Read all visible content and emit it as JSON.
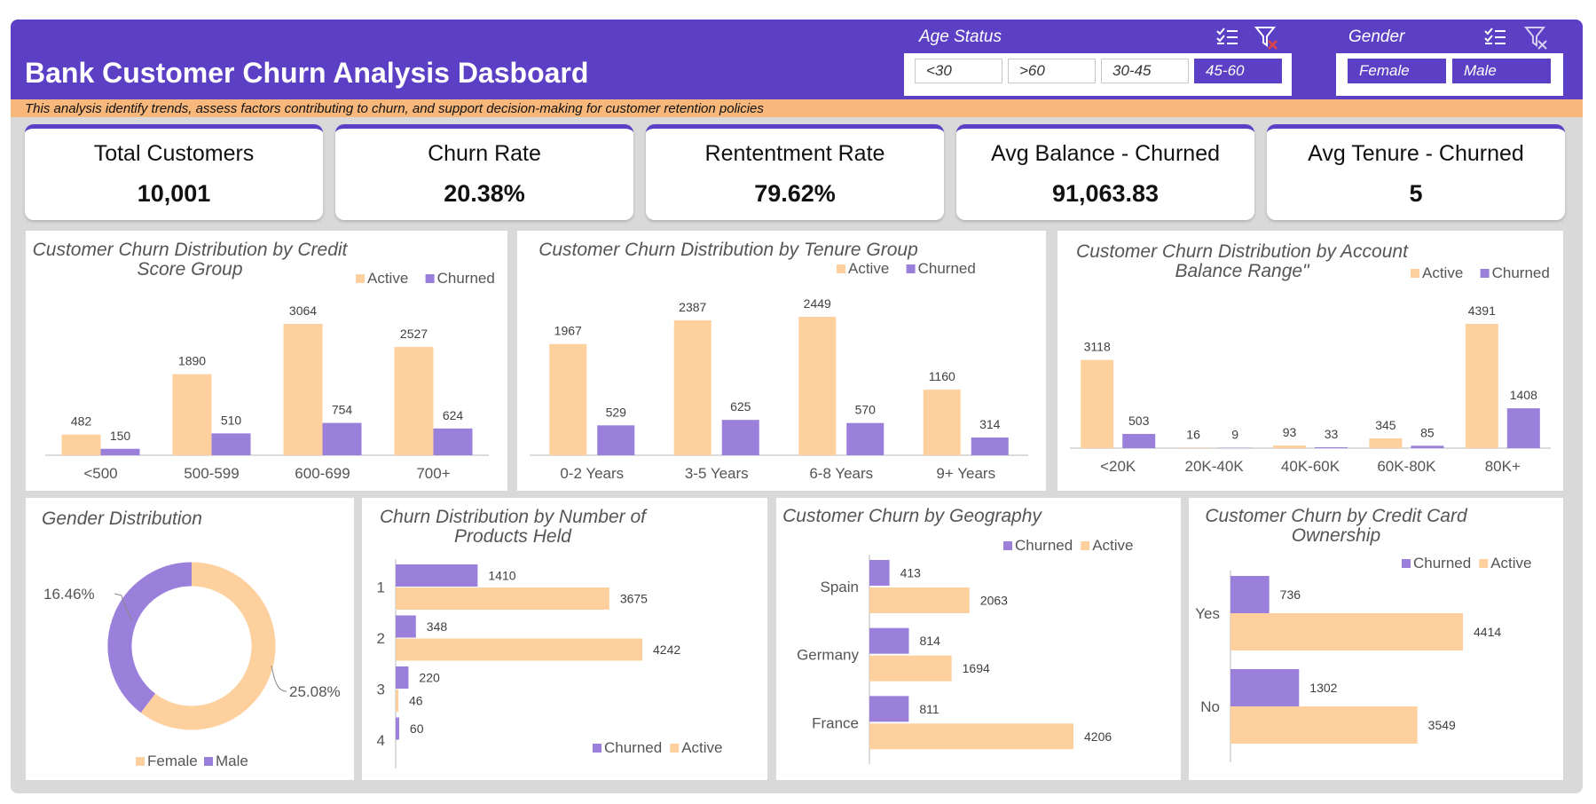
{
  "header": {
    "title": "Bank Customer Churn Analysis Dasboard",
    "subtitle": "This analysis identify trends, assess factors contributing to churn, and support decision-making for customer retention policies"
  },
  "colors": {
    "header": "#5b3fc4",
    "banner": "#f8b77b",
    "active": "#fdd09e",
    "churned": "#9a7fdb"
  },
  "slicers": {
    "age": {
      "label": "Age Status",
      "icons": [
        "multi-select-icon",
        "clear-filter-icon"
      ],
      "options": [
        {
          "label": "<30",
          "selected": false
        },
        {
          "label": ">60",
          "selected": false
        },
        {
          "label": "30-45",
          "selected": false
        },
        {
          "label": "45-60",
          "selected": true
        }
      ]
    },
    "gender": {
      "label": "Gender",
      "icons": [
        "multi-select-icon",
        "clear-filter-icon"
      ],
      "options": [
        {
          "label": "Female",
          "selected": true
        },
        {
          "label": "Male",
          "selected": true
        }
      ]
    }
  },
  "kpis": [
    {
      "label": "Total Customers",
      "value": "10,001"
    },
    {
      "label": "Churn Rate",
      "value": "20.38%"
    },
    {
      "label": "Rententment Rate",
      "value": "79.62%"
    },
    {
      "label": "Avg Balance - Churned",
      "value": "91,063.83"
    },
    {
      "label": "Avg Tenure - Churned",
      "value": "5"
    }
  ],
  "chart_data": [
    {
      "id": "credit",
      "type": "bar",
      "title": [
        "Customer Churn Distribution by Credit",
        "Score Group"
      ],
      "categories": [
        "<500",
        "500-599",
        "600-699",
        "700+"
      ],
      "series": [
        {
          "name": "Active",
          "values": [
            482,
            1890,
            3064,
            2527
          ]
        },
        {
          "name": "Churned",
          "values": [
            150,
            510,
            754,
            624
          ]
        }
      ],
      "ylim": [
        0,
        3064
      ],
      "legend": "top-right",
      "grid": false
    },
    {
      "id": "tenure",
      "type": "bar",
      "title": [
        "Customer Churn Distribution by Tenure Group"
      ],
      "categories": [
        "0-2 Years",
        "3-5 Years",
        "6-8 Years",
        "9+ Years"
      ],
      "series": [
        {
          "name": "Active",
          "values": [
            1967,
            2387,
            2449,
            1160
          ]
        },
        {
          "name": "Churned",
          "values": [
            529,
            625,
            570,
            314
          ]
        }
      ],
      "ylim": [
        0,
        2449
      ],
      "legend": "top-right",
      "grid": false
    },
    {
      "id": "balance",
      "type": "bar",
      "title": [
        "Customer Churn Distribution by Account",
        "Balance Range\""
      ],
      "categories": [
        "<20K",
        "20K-40K",
        "40K-60K",
        "60K-80K",
        "80K+"
      ],
      "series": [
        {
          "name": "Active",
          "values": [
            3118,
            16,
            93,
            345,
            4391
          ]
        },
        {
          "name": "Churned",
          "values": [
            503,
            9,
            33,
            85,
            1408
          ]
        }
      ],
      "ylim": [
        0,
        4391
      ],
      "legend": "top-right",
      "grid": false
    },
    {
      "id": "gender",
      "type": "pie",
      "title": [
        "Gender Distribution"
      ],
      "categories": [
        "Female",
        "Male"
      ],
      "labels": [
        "25.08%",
        "16.46%"
      ],
      "values": [
        25.08,
        16.46
      ],
      "legend": "bottom"
    },
    {
      "id": "products",
      "type": "bar",
      "orientation": "horizontal",
      "title": [
        "Churn Distribution by Number of",
        "Products Held"
      ],
      "categories": [
        "1",
        "2",
        "3",
        "4"
      ],
      "series": [
        {
          "name": "Churned",
          "values": [
            1410,
            348,
            220,
            60
          ]
        },
        {
          "name": "Active",
          "values": [
            3675,
            4242,
            46,
            0
          ]
        }
      ],
      "xlim": [
        0,
        4242
      ],
      "legend": "bottom-right",
      "grid": false
    },
    {
      "id": "geography",
      "type": "bar",
      "orientation": "horizontal",
      "title": [
        "Customer Churn by Geography"
      ],
      "categories": [
        "Spain",
        "Germany",
        "France"
      ],
      "series": [
        {
          "name": "Churned",
          "values": [
            413,
            814,
            811
          ]
        },
        {
          "name": "Active",
          "values": [
            2063,
            1694,
            4206
          ]
        }
      ],
      "xlim": [
        0,
        4206
      ],
      "legend": "top-right",
      "grid": false
    },
    {
      "id": "card",
      "type": "bar",
      "orientation": "horizontal",
      "title": [
        "Customer Churn by Credit Card",
        "Ownership"
      ],
      "categories": [
        "Yes",
        "No"
      ],
      "series": [
        {
          "name": "Churned",
          "values": [
            736,
            1302
          ]
        },
        {
          "name": "Active",
          "values": [
            4414,
            3549
          ]
        }
      ],
      "xlim": [
        0,
        4414
      ],
      "legend": "top-right",
      "grid": false
    }
  ]
}
